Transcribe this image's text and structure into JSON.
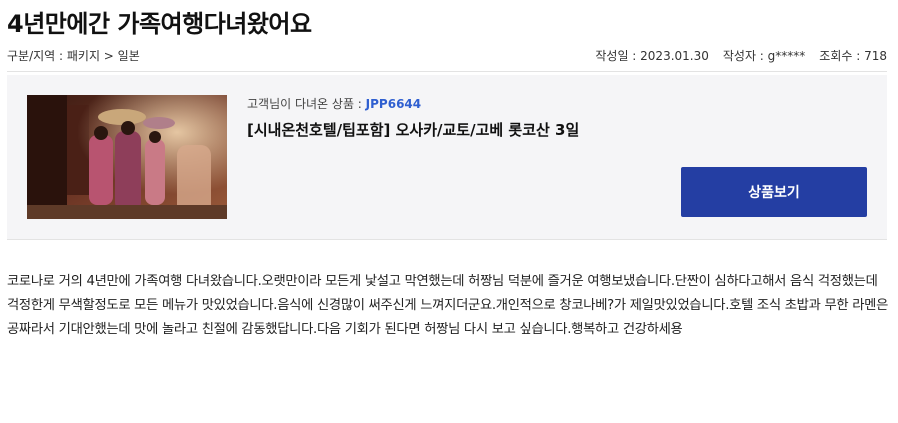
{
  "post": {
    "title": "4년만에간 가족여행다녀왔어요",
    "category_line": "구분/지역 : 패키지 > 일본",
    "date_label": "작성일 : 2023.01.30",
    "author_label": "작성자 : g*****",
    "views_label": "조회수 : 718"
  },
  "product": {
    "code_prefix": "고객님이 다녀온 상품 : ",
    "code": "JPP6644",
    "name": "[시내온천호텔/팁포함] 오사카/교토/고베 롯코산 3일",
    "view_button": "상품보기"
  },
  "review": {
    "body": " 코로나로 거의 4년만에 가족여행 다녀왔습니다.오랫만이라 모든게 낯설고 막연했는데 허짱님 덕분에 즐거운 여행보냈습니다.단짠이 심하다고해서 음식 걱정했는데 걱정한게 무색할정도로 모든 메뉴가 맛있었습니다.음식에 신경많이 써주신게 느껴지더군요.개인적으로 창코나베?가 제일맛있었습니다.호텔 조식 초밥과 무한 라멘은 공짜라서 기대안했는데 맛에 놀라고 친절에 감동했답니다.다음 기회가 된다면 허짱님 다시 보고 싶습니다.행복하고 건강하세용"
  },
  "colors": {
    "accent_button": "#243ea3",
    "product_code": "#2f5fd0",
    "box_background": "#f5f5f7"
  }
}
